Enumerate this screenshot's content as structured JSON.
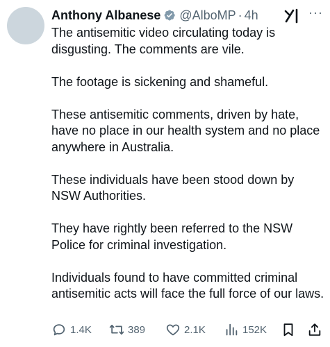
{
  "author": {
    "name": "Anthony Albanese",
    "handle": "@AlboMP",
    "separator": "·",
    "time": "4h",
    "verified_color": "#829aab"
  },
  "icons": {
    "verified": "verified-badge-icon",
    "grok": "grok-icon",
    "more": "more-icon"
  },
  "tweet": {
    "paragraphs": [
      "The antisemitic video circulating today is disgusting. The comments are vile.",
      "The footage is sickening and shameful.",
      "These antisemitic comments, driven by hate, have no place in our health system and no place anywhere in Australia.",
      "These individuals have been stood down by NSW Authorities.",
      "They have rightly been referred to the NSW Police for criminal investigation.",
      "Individuals found to have committed criminal antisemitic acts will face the full force of our laws."
    ]
  },
  "actions": {
    "replies": "1.4K",
    "reposts": "389",
    "likes": "2.1K",
    "views": "152K"
  },
  "colors": {
    "text": "#0f1419",
    "muted": "#536471"
  }
}
